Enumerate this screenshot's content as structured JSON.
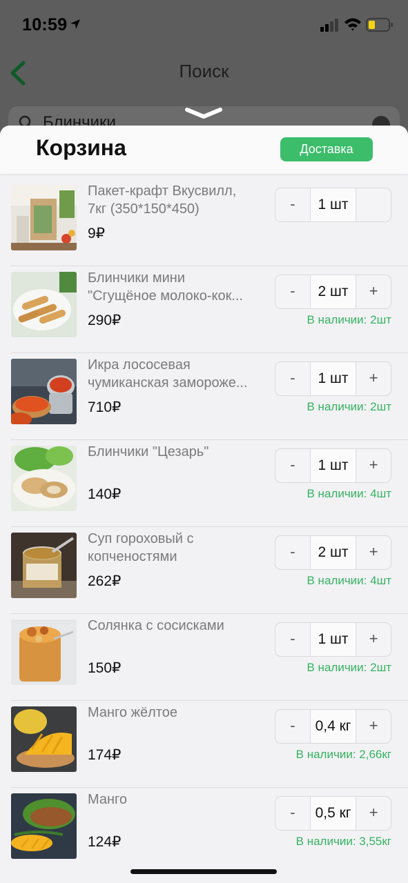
{
  "status_bar": {
    "time": "10:59"
  },
  "background": {
    "title": "Поиск",
    "search_value": "Блинчики"
  },
  "sheet": {
    "title": "Корзина",
    "delivery_button": "Доставка"
  },
  "items": [
    {
      "name_lines": [
        "Пакет-крафт Вкусвилл,",
        "7кг (350*150*450)"
      ],
      "price": "9₽",
      "qty": "1 шт",
      "minus": "-",
      "plus": "",
      "stock": ""
    },
    {
      "name_lines": [
        "Блинчики мини",
        "\"Сгущёное молоко-кок..."
      ],
      "price": "290₽",
      "qty": "2 шт",
      "minus": "-",
      "plus": "+",
      "stock": "В наличии: 2шт"
    },
    {
      "name_lines": [
        "Икра лососевая",
        "чумиканская замороже..."
      ],
      "price": "710₽",
      "qty": "1 шт",
      "minus": "-",
      "plus": "+",
      "stock": "В наличии: 2шт"
    },
    {
      "name_lines": [
        "Блинчики \"Цезарь\""
      ],
      "price": "140₽",
      "qty": "1 шт",
      "minus": "-",
      "plus": "+",
      "stock": "В наличии: 4шт"
    },
    {
      "name_lines": [
        "Суп гороховый с",
        "копченостями"
      ],
      "price": "262₽",
      "qty": "2 шт",
      "minus": "-",
      "plus": "+",
      "stock": "В наличии: 4шт"
    },
    {
      "name_lines": [
        "Солянка с сосисками"
      ],
      "price": "150₽",
      "qty": "1 шт",
      "minus": "-",
      "plus": "+",
      "stock": "В наличии: 2шт"
    },
    {
      "name_lines": [
        "Манго жёлтое"
      ],
      "price": "174₽",
      "qty": "0,4 кг",
      "minus": "-",
      "plus": "+",
      "stock": "В наличии: 2,66кг"
    },
    {
      "name_lines": [
        "Манго"
      ],
      "price": "124₽",
      "qty": "0,5 кг",
      "minus": "-",
      "plus": "+",
      "stock": "В наличии: 3,55кг"
    }
  ],
  "colors": {
    "accent": "#3bbd6a",
    "stock_text": "#34b35f",
    "overlay": "#5d5d5d"
  }
}
